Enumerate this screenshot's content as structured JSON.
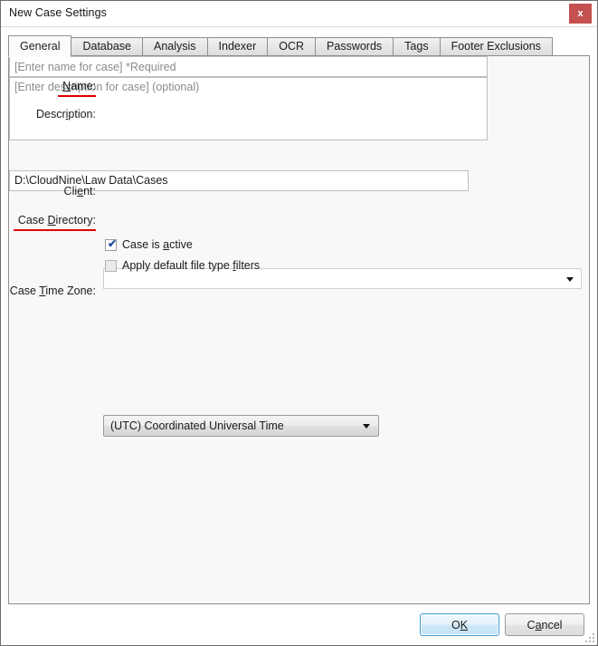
{
  "window": {
    "title": "New Case Settings",
    "close_label": "x"
  },
  "tabs": [
    {
      "label": "General",
      "active": true
    },
    {
      "label": "Database",
      "active": false
    },
    {
      "label": "Analysis",
      "active": false
    },
    {
      "label": "Indexer",
      "active": false
    },
    {
      "label": "OCR",
      "active": false
    },
    {
      "label": "Passwords",
      "active": false
    },
    {
      "label": "Tags",
      "active": false
    },
    {
      "label": "Footer Exclusions",
      "active": false
    }
  ],
  "general": {
    "name": {
      "label_pre": "",
      "label_acc": "N",
      "label_post": "ame:",
      "value": "",
      "placeholder": "[Enter name for case] *Required",
      "required_underline": true
    },
    "description": {
      "label_pre": "Descr",
      "label_acc": "i",
      "label_post": "ption:",
      "value": "",
      "placeholder": "[Enter description for case] (optional)",
      "required_underline": false
    },
    "client": {
      "label_pre": "Cli",
      "label_acc": "e",
      "label_post": "nt:",
      "value": "",
      "required_underline": false
    },
    "case_directory": {
      "label_pre": "Case ",
      "label_acc": "D",
      "label_post": "irectory:",
      "value": "D:\\CloudNine\\Law Data\\Cases",
      "browse_label": "...",
      "required_underline": true
    },
    "case_is_active": {
      "label_pre": "Case is ",
      "label_acc": "a",
      "label_post": "ctive",
      "checked": true,
      "check_glyph": "✔"
    },
    "apply_default_filters": {
      "label_pre": "Apply default file type ",
      "label_acc": "f",
      "label_post": "ilters",
      "checked": false,
      "check_glyph": ""
    },
    "case_time_zone": {
      "label_pre": "Case ",
      "label_acc": "T",
      "label_post": "ime Zone:",
      "value": "(UTC) Coordinated Universal Time"
    }
  },
  "footer": {
    "ok": {
      "pre": "O",
      "acc": "K",
      "post": ""
    },
    "cancel": {
      "pre": "C",
      "acc": "a",
      "post": "ncel"
    }
  },
  "colors": {
    "required_underline": "#e00000",
    "close_button": "#c4504f",
    "default_button_border": "#3c9ad4",
    "checkmark": "#1d4fa0"
  }
}
